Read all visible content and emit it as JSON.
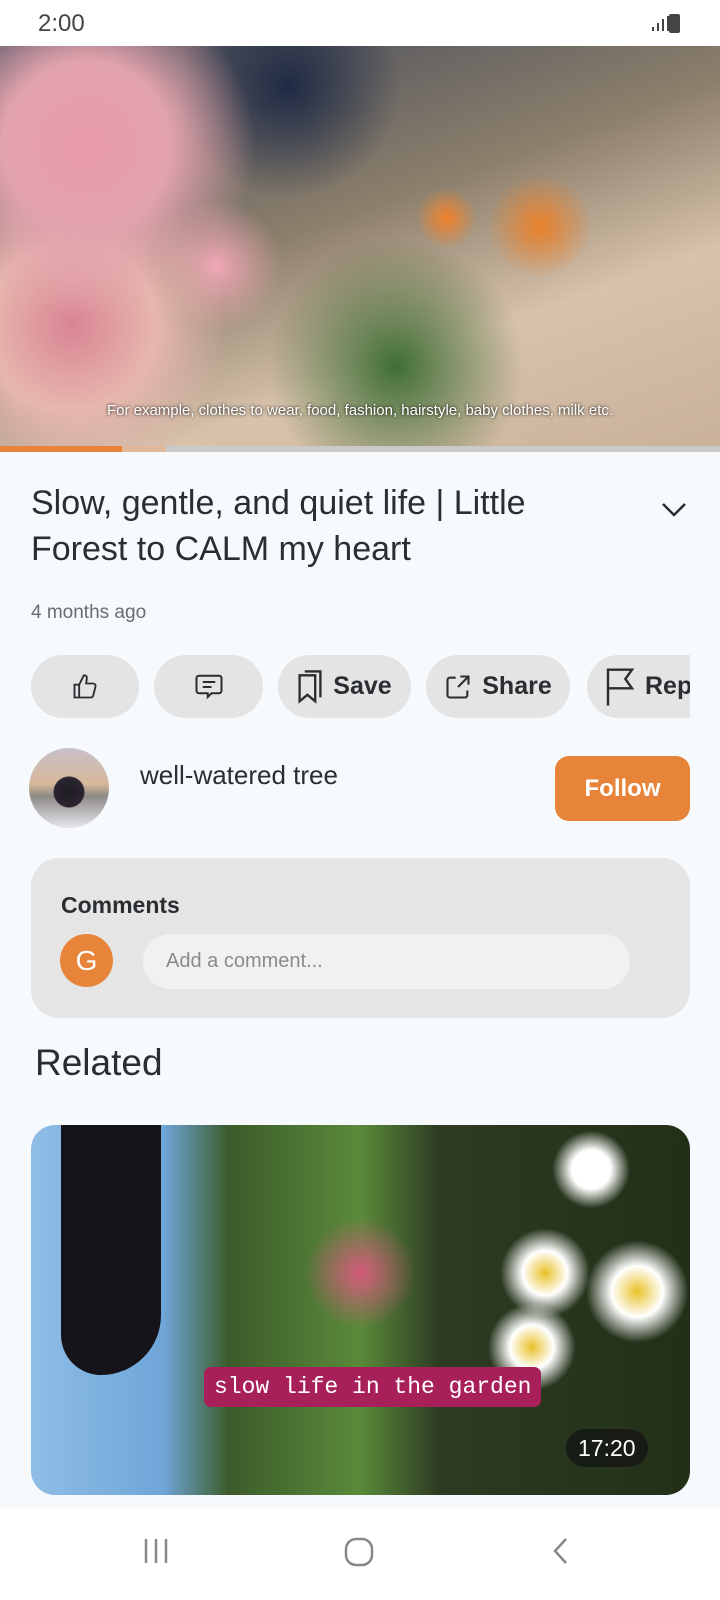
{
  "status_bar": {
    "time": "2:00",
    "icons": [
      "signal-icon",
      "battery-icon"
    ]
  },
  "video": {
    "subtitle": "For example, clothes to wear, food, fashion, hairstyle, baby clothes, milk etc.",
    "progress_percent": 17,
    "buffered_percent": 23,
    "accent": "#E8833A"
  },
  "info": {
    "title": "Slow, gentle, and quiet life | Little Forest  to CALM my heart",
    "posted": "4 months ago"
  },
  "actions": [
    {
      "icon": "thumbs-up-icon",
      "label": ""
    },
    {
      "icon": "comment-icon",
      "label": ""
    },
    {
      "icon": "bookmark-icon",
      "label": "Save"
    },
    {
      "icon": "share-icon",
      "label": "Share"
    },
    {
      "icon": "flag-icon",
      "label": "Rep"
    }
  ],
  "channel": {
    "name": "well-watered tree",
    "follow_label": "Follow"
  },
  "comments": {
    "title": "Comments",
    "user_initial": "G",
    "placeholder": "Add a comment..."
  },
  "related": {
    "heading": "Related",
    "items": [
      {
        "overlay_text": "slow life in the garden",
        "duration": "17:20"
      }
    ]
  },
  "nav": {
    "icons": [
      "recents-icon",
      "home-icon",
      "back-icon"
    ]
  }
}
